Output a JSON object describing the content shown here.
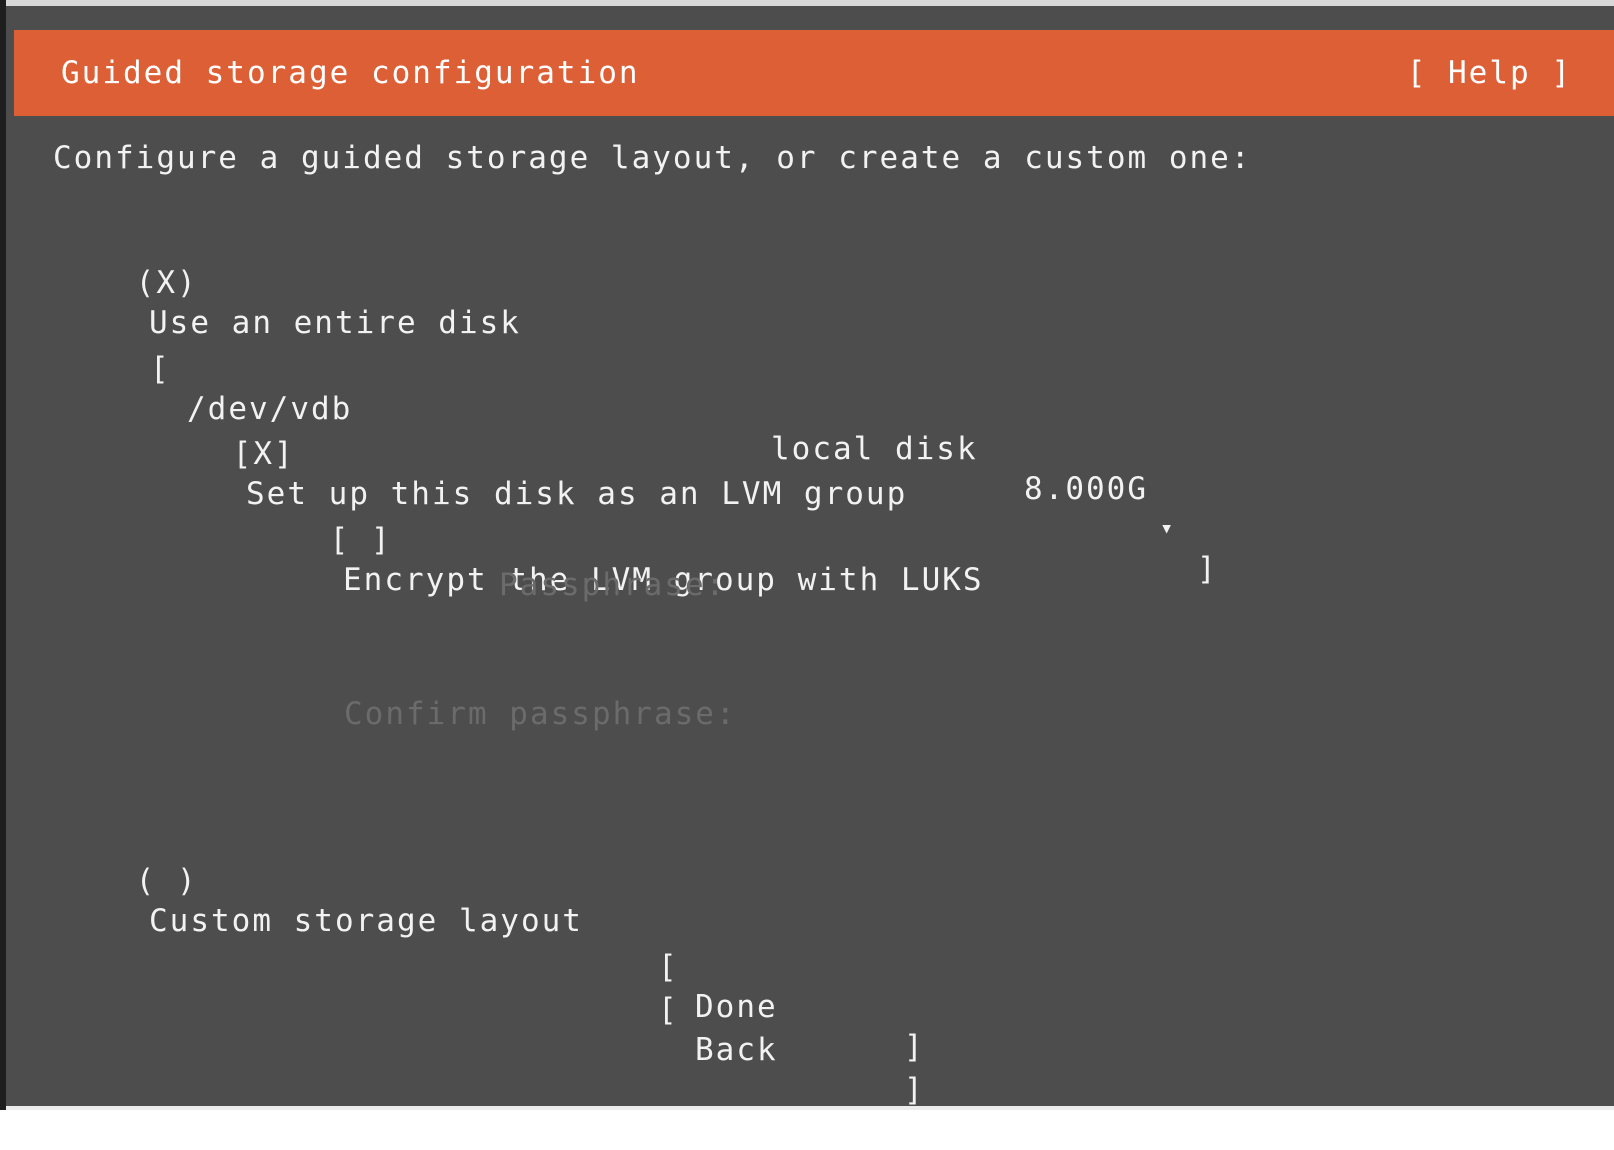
{
  "header": {
    "title": "Guided storage configuration",
    "help": "[ Help ]"
  },
  "intro": "Configure a guided storage layout, or create a custom one:",
  "options": {
    "entire_disk": {
      "radio": "(X)",
      "label": "Use an entire disk"
    },
    "custom": {
      "radio": "( )",
      "label": "Custom storage layout"
    }
  },
  "disk_select": {
    "open_bracket": "[",
    "device": "/dev/vdb",
    "type": "local disk",
    "size": "8.000G",
    "arrow": "▾",
    "close_bracket": "]"
  },
  "lvm": {
    "checkbox": "[X]",
    "label": "Set up this disk as an LVM group"
  },
  "luks": {
    "checkbox": "[ ]",
    "label": "Encrypt the LVM group with LUKS"
  },
  "passphrase_label": "Passphrase:",
  "confirm_passphrase_label": "Confirm passphrase:",
  "buttons": {
    "done": {
      "open": "[",
      "label": "Done",
      "close": "]"
    },
    "back": {
      "open": "[",
      "label": "Back",
      "close": "]"
    }
  },
  "colors": {
    "header_bg": "#dd5f36",
    "panel_bg": "#4d4d4d",
    "text": "#f2f2f2",
    "disabled_text": "#6b6b6b"
  }
}
